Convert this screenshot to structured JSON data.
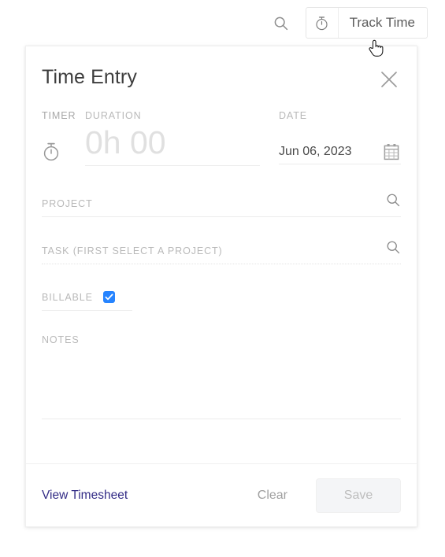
{
  "topbar": {
    "search_icon": "search-icon",
    "track_time": {
      "icon": "stopwatch-icon",
      "label": "Track Time"
    }
  },
  "cursor": {
    "type": "pointing-hand-cursor"
  },
  "panel": {
    "title": "Time Entry",
    "close_icon": "close-x-icon",
    "timer": {
      "label": "TIMER",
      "icon": "stopwatch-icon"
    },
    "duration": {
      "label": "DURATION",
      "value": "",
      "placeholder": "0h 00"
    },
    "date": {
      "label": "DATE",
      "value": "Jun 06, 2023",
      "icon": "calendar-icon"
    },
    "project": {
      "label": "PROJECT",
      "value": "",
      "placeholder": "PROJECT",
      "icon": "search-icon"
    },
    "task": {
      "label": "TASK (FIRST SELECT A PROJECT)",
      "value": "",
      "placeholder": "TASK (FIRST SELECT A PROJECT)",
      "icon": "search-icon",
      "disabled": true
    },
    "billable": {
      "label": "BILLABLE",
      "checked": true,
      "accent_color": "#2684ff"
    },
    "notes": {
      "label": "NOTES",
      "value": ""
    },
    "footer": {
      "view_timesheet": "View Timesheet",
      "view_timesheet_color": "#332c86",
      "clear": "Clear",
      "save": "Save",
      "save_disabled": true
    }
  }
}
